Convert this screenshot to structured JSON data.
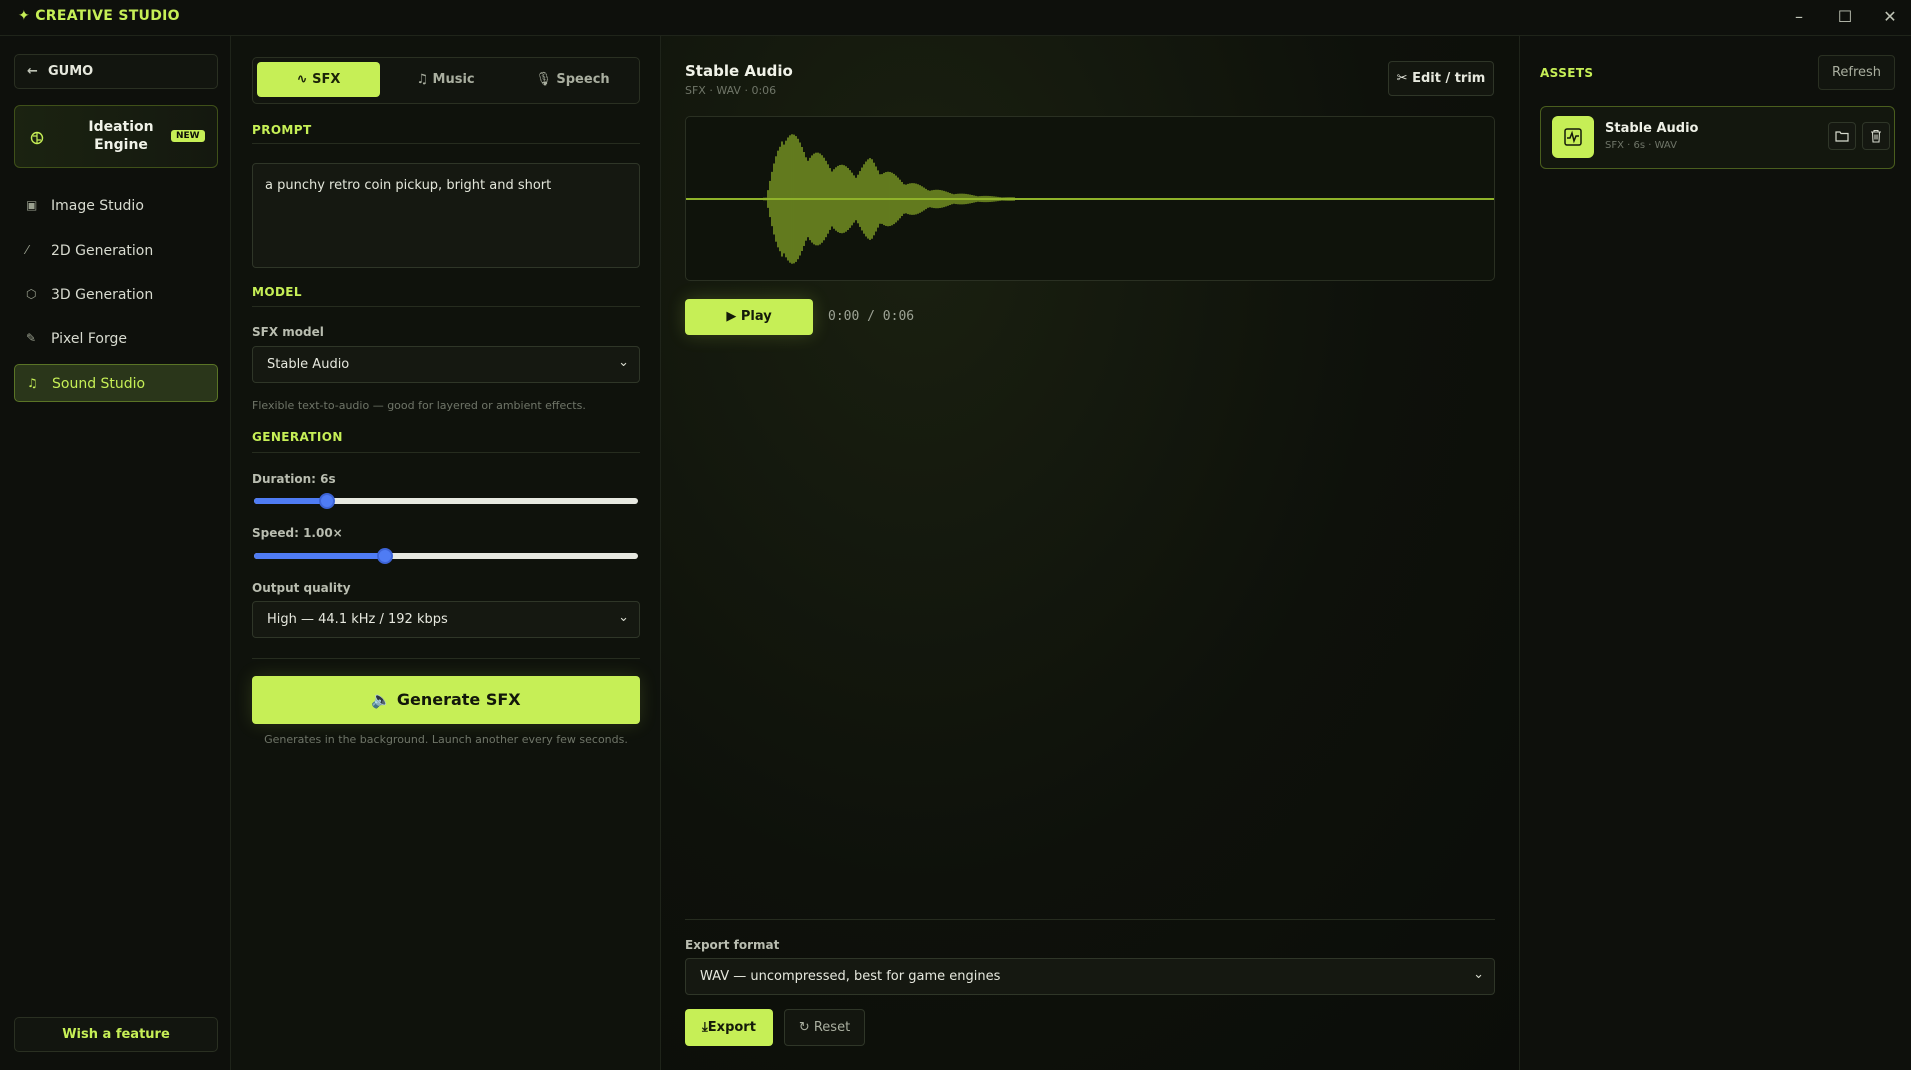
{
  "app": {
    "title": "CREATIVE STUDIO",
    "logo_icon": "sparkle-icon"
  },
  "window_controls": [
    "minimize-icon",
    "maximize-icon",
    "close-icon"
  ],
  "sidebar": {
    "back_label": "GUMO",
    "ideation": {
      "title": "Ideation Engine",
      "badge": "NEW"
    },
    "items": [
      {
        "label": "Image Studio",
        "icon": "image-icon",
        "active": false
      },
      {
        "label": "2D Generation",
        "icon": "wand-icon",
        "active": false
      },
      {
        "label": "3D Generation",
        "icon": "cube-icon",
        "active": false
      },
      {
        "label": "Pixel Forge",
        "icon": "brush-icon",
        "active": false
      },
      {
        "label": "Sound Studio",
        "icon": "music-note-icon",
        "active": true
      }
    ],
    "wish_label": "Wish a feature"
  },
  "settings": {
    "tabs": [
      {
        "label": "SFX",
        "active": true
      },
      {
        "label": "Music",
        "active": false
      },
      {
        "label": "Speech",
        "active": false
      }
    ],
    "prompt_header": "PROMPT",
    "prompt_value": "a punchy retro coin pickup, bright and short",
    "model_header": "MODEL",
    "sfx_model_label": "SFX model",
    "sfx_model_value": "Stable Audio",
    "model_hint": "Flexible text-to-audio — good for layered or ambient effects.",
    "generation_header": "GENERATION",
    "duration_label": "Duration: 6s",
    "duration_fraction": 0.19,
    "speed_label": "Speed: 1.00×",
    "speed_fraction": 0.34,
    "quality_label": "Output quality",
    "quality_value": "High — 44.1 kHz / 192 kbps",
    "generate_label": "Generate SFX",
    "generate_hint": "Generates in the background. Launch another every few seconds."
  },
  "preview": {
    "title": "Stable Audio",
    "subtitle": "SFX · WAV · 0:06",
    "edit_label": "Edit / trim",
    "play_label": "Play",
    "time": "0:00 / 0:06",
    "waveform_color": "#8fb32a",
    "export_label": "Export format",
    "export_value": "WAV — uncompressed, best for game engines",
    "export_button": "Export",
    "reset_button": "Reset"
  },
  "assets": {
    "title": "ASSETS",
    "refresh_label": "Refresh",
    "items": [
      {
        "name": "Stable Audio",
        "meta": "SFX · 6s · WAV"
      }
    ]
  },
  "colors": {
    "accent": "#c6ef56",
    "background": "#0b0d09",
    "slider": "#4f7cf4"
  }
}
